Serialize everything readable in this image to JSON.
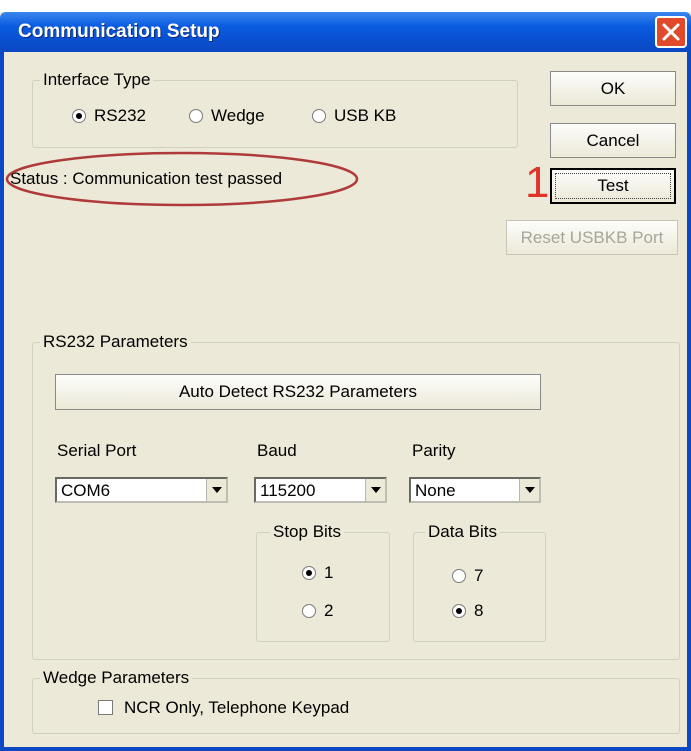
{
  "window": {
    "title": "Communication Setup"
  },
  "interface_type": {
    "legend": "Interface Type",
    "options": [
      {
        "label": "RS232",
        "selected": true
      },
      {
        "label": "Wedge",
        "selected": false
      },
      {
        "label": "USB KB",
        "selected": false
      }
    ]
  },
  "status": {
    "text": "Status : Communication test passed"
  },
  "annotation": {
    "marker": "1",
    "color": "#e0332a"
  },
  "buttons": {
    "ok": "OK",
    "cancel": "Cancel",
    "test": "Test",
    "reset_usbkb": "Reset USBKB Port"
  },
  "rs232": {
    "legend": "RS232 Parameters",
    "auto_detect": "Auto Detect RS232 Parameters",
    "serial_port": {
      "label": "Serial Port",
      "value": "COM6"
    },
    "baud": {
      "label": "Baud",
      "value": "115200"
    },
    "parity": {
      "label": "Parity",
      "value": "None"
    },
    "stop_bits": {
      "legend": "Stop Bits",
      "options": [
        {
          "label": "1",
          "selected": true
        },
        {
          "label": "2",
          "selected": false
        }
      ]
    },
    "data_bits": {
      "legend": "Data Bits",
      "options": [
        {
          "label": "7",
          "selected": false
        },
        {
          "label": "8",
          "selected": true
        }
      ]
    }
  },
  "wedge": {
    "legend": "Wedge Parameters",
    "ncr_only": {
      "label": "NCR Only, Telephone Keypad",
      "checked": false
    }
  },
  "colors": {
    "titlebar": "#0a4fd0",
    "dialog_bg": "#ece9d8",
    "close_button": "#e04a2a"
  }
}
